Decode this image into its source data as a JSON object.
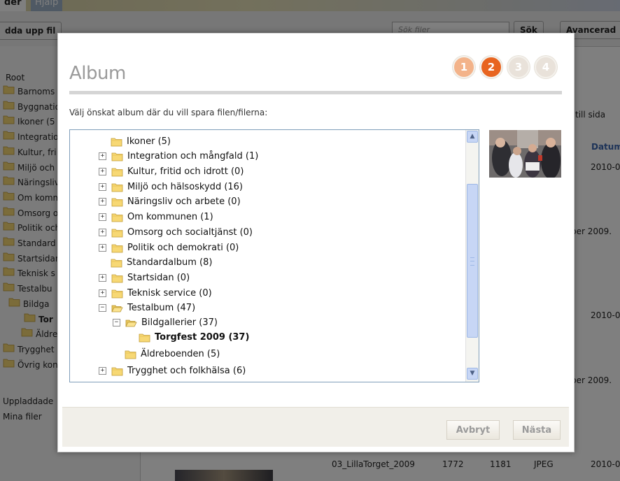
{
  "background": {
    "tabs": [
      "der",
      "Hjälp"
    ],
    "upload_button": "dda upp fil",
    "search_placeholder": "Sök filer",
    "search_button": "Sök",
    "advanced_button": "Avancerad",
    "root_label": "Root",
    "sidebar_items": [
      "Barnoms",
      "Byggnatio",
      "Ikoner (5",
      "Integratio",
      "Kultur, fri",
      "Miljö och",
      "Näringsliv",
      "Om komm",
      "Omsorg o",
      "Politik och",
      "Standard",
      "Startsidan",
      "Teknisk s",
      "Testalbu",
      "Bildga",
      "Tor",
      "Äldrebo",
      "Trygghet",
      "Övrig kon"
    ],
    "uploaded_label": "Uppladdade",
    "my_files_label": "Mina filer",
    "per_page_label": "till sida",
    "date_header": "Datum",
    "dates": [
      "2010-0",
      "2010-0",
      "2010-0"
    ],
    "period_text": [
      "ber 2009.",
      "ber 2009."
    ],
    "row": {
      "name": "03_LillaTorget_2009",
      "width": "1772",
      "height": "1181",
      "type": "JPEG",
      "date": "2010-0"
    }
  },
  "dialog": {
    "title": "Album",
    "steps": [
      "1",
      "2",
      "3",
      "4"
    ],
    "active_step": 2,
    "instructions": "Välj önskat album där du vill spara filen/filerna:",
    "tree": [
      {
        "label": "Ikoner (5)",
        "level": 0,
        "expander": "none",
        "open": false,
        "bold": false
      },
      {
        "label": "Integration och mångfald (1)",
        "level": 0,
        "expander": "+",
        "open": false,
        "bold": false
      },
      {
        "label": "Kultur, fritid och idrott (0)",
        "level": 0,
        "expander": "+",
        "open": false,
        "bold": false
      },
      {
        "label": "Miljö och hälsoskydd (16)",
        "level": 0,
        "expander": "+",
        "open": false,
        "bold": false
      },
      {
        "label": "Näringsliv och arbete (0)",
        "level": 0,
        "expander": "+",
        "open": false,
        "bold": false
      },
      {
        "label": "Om kommunen (1)",
        "level": 0,
        "expander": "+",
        "open": false,
        "bold": false
      },
      {
        "label": "Omsorg och socialtjänst (0)",
        "level": 0,
        "expander": "+",
        "open": false,
        "bold": false
      },
      {
        "label": "Politik och demokrati (0)",
        "level": 0,
        "expander": "+",
        "open": false,
        "bold": false
      },
      {
        "label": "Standardalbum (8)",
        "level": 0,
        "expander": "none",
        "open": false,
        "bold": false
      },
      {
        "label": "Startsidan (0)",
        "level": 0,
        "expander": "+",
        "open": false,
        "bold": false
      },
      {
        "label": "Teknisk service (0)",
        "level": 0,
        "expander": "+",
        "open": false,
        "bold": false
      },
      {
        "label": "Testalbum (47)",
        "level": 0,
        "expander": "-",
        "open": true,
        "bold": false
      },
      {
        "label": "Bildgallerier (37)",
        "level": 1,
        "expander": "-",
        "open": true,
        "bold": false
      },
      {
        "label": "Torgfest 2009 (37)",
        "level": 2,
        "expander": "none",
        "open": false,
        "bold": true
      },
      {
        "label": "Äldreboenden (5)",
        "level": 1,
        "expander": "none",
        "open": false,
        "bold": false
      },
      {
        "label": "Trygghet och folkhälsa (6)",
        "level": 0,
        "expander": "+",
        "open": false,
        "bold": false
      }
    ],
    "scroll_up_icon": "arrow-up-icon",
    "scroll_down_icon": "arrow-down-icon",
    "cancel_button": "Avbryt",
    "next_button": "Nästa",
    "colors": {
      "active_step": "#e8641f",
      "done_step": "#f3b38a",
      "todo_step": "#e9e2da"
    }
  }
}
